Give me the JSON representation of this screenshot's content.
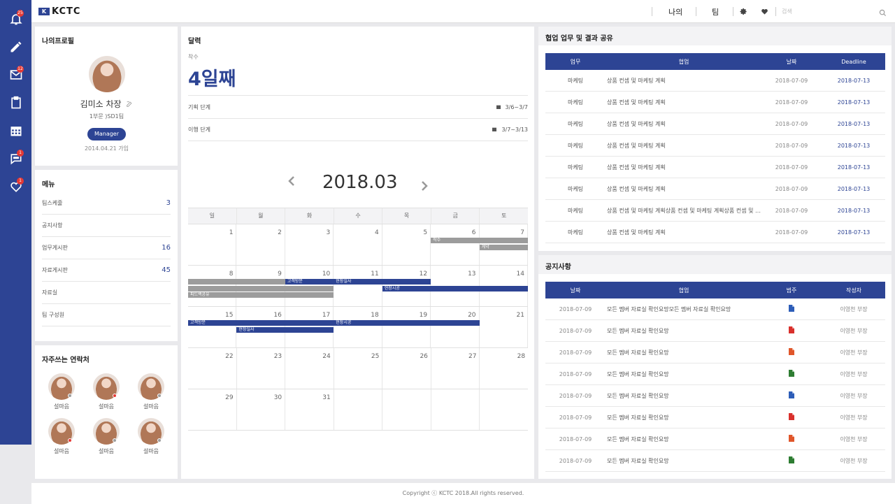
{
  "brand": {
    "logo_mark": "K",
    "logo_text": "KCTC"
  },
  "sidebar": {
    "items": [
      {
        "icon": "bell-icon",
        "badge": "25"
      },
      {
        "icon": "pencil-icon",
        "badge": ""
      },
      {
        "icon": "mail-icon",
        "badge": "12"
      },
      {
        "icon": "clipboard-icon",
        "badge": ""
      },
      {
        "icon": "calendar-icon",
        "badge": ""
      },
      {
        "icon": "chat-icon",
        "badge": "1"
      },
      {
        "icon": "heart-icon",
        "badge": "1"
      }
    ]
  },
  "topbar": {
    "nav_me": "나의",
    "nav_team": "팀",
    "search_placeholder": "검색"
  },
  "profile": {
    "title": "나의프로필",
    "name": "김미소 차장",
    "dept": "1부문 )SD1팀",
    "role": "Manager",
    "joined": "2014.04.21 가입"
  },
  "menu": {
    "title": "메뉴",
    "items": [
      {
        "label": "팀스케줄",
        "count": "3"
      },
      {
        "label": "공지사항",
        "count": ""
      },
      {
        "label": "업무게시판",
        "count": "16"
      },
      {
        "label": "자료게시판",
        "count": "45"
      },
      {
        "label": "자료실",
        "count": ""
      },
      {
        "label": "팀 구성원",
        "count": ""
      }
    ]
  },
  "contacts": {
    "title": "자주쓰는 연락처",
    "items": [
      {
        "name": "설마음",
        "status": "#9e9e9e"
      },
      {
        "name": "설마음",
        "status": "#e53935"
      },
      {
        "name": "설마음",
        "status": "#9e9e9e"
      },
      {
        "name": "설마음",
        "status": "#e53935"
      },
      {
        "name": "설마음",
        "status": "#9e9e9e"
      },
      {
        "name": "설마음",
        "status": "#9e9e9e"
      }
    ]
  },
  "calendar": {
    "title": "달력",
    "start_label": "착수",
    "day_count": "4일째",
    "phases": [
      {
        "label": "기획 단계",
        "range": "3/6~3/7"
      },
      {
        "label": "이행 단계",
        "range": "3/7~3/13"
      }
    ],
    "month": "2018.03",
    "weekdays": [
      "일",
      "월",
      "화",
      "수",
      "목",
      "금",
      "토"
    ],
    "weeks": [
      [
        "",
        "",
        "",
        "",
        "",
        "",
        ""
      ],
      [
        "",
        "",
        "",
        "",
        "",
        "",
        ""
      ],
      [
        "",
        "",
        "",
        "",
        "",
        "",
        ""
      ],
      [
        "",
        "",
        "",
        "",
        "",
        "",
        ""
      ],
      [
        "",
        "",
        "",
        "",
        "",
        "",
        ""
      ]
    ],
    "day_numbers": [
      [
        "1",
        "2",
        "3",
        "4",
        "5",
        "6",
        "7"
      ],
      [
        "8",
        "9",
        "10",
        "11",
        "12",
        "13",
        "14"
      ],
      [
        "15",
        "16",
        "17",
        "18",
        "19",
        "20",
        "21"
      ],
      [
        "22",
        "23",
        "24",
        "25",
        "26",
        "27",
        "28"
      ],
      [
        "29",
        "30",
        "31",
        "",
        "",
        "",
        ""
      ]
    ],
    "events": {
      "e1": "착수",
      "e2": "계약",
      "e3": "",
      "e4": "",
      "e5": "피드백공유",
      "e6": "고객방문",
      "e7": "현장실사",
      "e8": "현장시공",
      "e9": "고객방문",
      "e10": "현장실사",
      "e11": "현장시공"
    }
  },
  "collab": {
    "title": "협업 업무 및 결과 공유",
    "headers": [
      "업무",
      "협업",
      "날짜",
      "Deadline"
    ],
    "rows": [
      [
        "마케팅",
        "상품 컨셉 및 마케팅 계획",
        "2018-07-09",
        "2018-07-13"
      ],
      [
        "마케팅",
        "상품 컨셉 및 마케팅 계획",
        "2018-07-09",
        "2018-07-13"
      ],
      [
        "마케팅",
        "상품 컨셉 및 마케팅 계획",
        "2018-07-09",
        "2018-07-13"
      ],
      [
        "마케팅",
        "상품 컨셉 및 마케팅 계획",
        "2018-07-09",
        "2018-07-13"
      ],
      [
        "마케팅",
        "상품 컨셉 및 마케팅 계획",
        "2018-07-09",
        "2018-07-13"
      ],
      [
        "마케팅",
        "상품 컨셉 및 마케팅 계획",
        "2018-07-09",
        "2018-07-13"
      ],
      [
        "마케팅",
        "상품 컨셉 및 마케팅 계획상품 컨셉 및 마케팅 계획상품 컨셉 및 마...",
        "2018-07-09",
        "2018-07-13"
      ],
      [
        "마케팅",
        "상품 컨셉 및 마케팅 계획",
        "2018-07-09",
        "2018-07-13"
      ]
    ]
  },
  "notice": {
    "title": "공지사항",
    "headers": [
      "날짜",
      "협업",
      "범주",
      "작성자"
    ],
    "rows": [
      {
        "date": "2018-07-09",
        "text": "모든 멤버 자료실 확인요망모든 멤버 자료실 확인요망",
        "file": "word",
        "color": "#2d5db8",
        "author": "이영천 부장"
      },
      {
        "date": "2018-07-09",
        "text": "모든 멤버 자료실 확인요망",
        "file": "pdf",
        "color": "#d9302c",
        "author": "이영천 부장"
      },
      {
        "date": "2018-07-09",
        "text": "모든 멤버 자료실 확인요망",
        "file": "ppt",
        "color": "#e0562a",
        "author": "이영천 부장"
      },
      {
        "date": "2018-07-09",
        "text": "모든 멤버 자료실 확인요망",
        "file": "excel",
        "color": "#2e7d32",
        "author": "이영천 부장"
      },
      {
        "date": "2018-07-09",
        "text": "모든 멤버 자료실 확인요망",
        "file": "word",
        "color": "#2d5db8",
        "author": "이영천 부장"
      },
      {
        "date": "2018-07-09",
        "text": "모든 멤버 자료실 확인요망",
        "file": "pdf",
        "color": "#d9302c",
        "author": "이영천 부장"
      },
      {
        "date": "2018-07-09",
        "text": "모든 멤버 자료실 확인요망",
        "file": "ppt",
        "color": "#e0562a",
        "author": "이영천 부장"
      },
      {
        "date": "2018-07-09",
        "text": "모든 멤버 자료실 확인요망",
        "file": "excel",
        "color": "#2e7d32",
        "author": "이영천 부장"
      }
    ]
  },
  "footer": {
    "copyright": "Copyright ⓒ KCTC 2018.All rights reserved."
  },
  "colors": {
    "brand": "#2d4494",
    "event_gray": "#9c9c9c",
    "badge": "#e53935"
  }
}
